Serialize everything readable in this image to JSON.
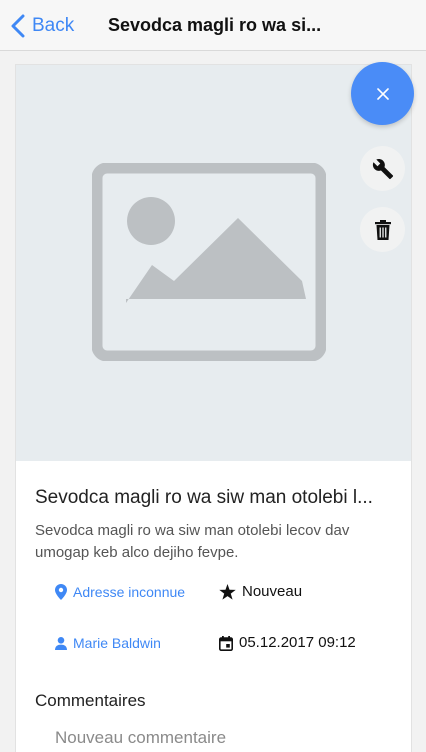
{
  "header": {
    "back_label": "Back",
    "title": "Sevodca magli ro wa si..."
  },
  "item": {
    "title": "Sevodca magli ro wa siw man otolebi l...",
    "description": "Sevodca magli ro wa siw man otolebi lecov dav umogap keb alco dejiho fevpe.",
    "location": "Adresse inconnue",
    "status": "Nouveau",
    "author": "Marie Baldwin",
    "date": "05.12.2017 09:12"
  },
  "comments": {
    "title": "Commentaires",
    "placeholder": "Nouveau commentaire"
  },
  "icons": {
    "back": "chevron-left-icon",
    "close": "close-icon",
    "edit": "wrench-icon",
    "delete": "trash-icon",
    "location": "location-pin-icon",
    "status": "star-icon",
    "author": "person-icon",
    "date": "calendar-icon",
    "placeholder": "image-placeholder-icon"
  },
  "colors": {
    "accent": "#3f88f5",
    "fab": "#4a8cf7",
    "image_bg": "#e7ecef",
    "placeholder": "#bcc0c3"
  }
}
